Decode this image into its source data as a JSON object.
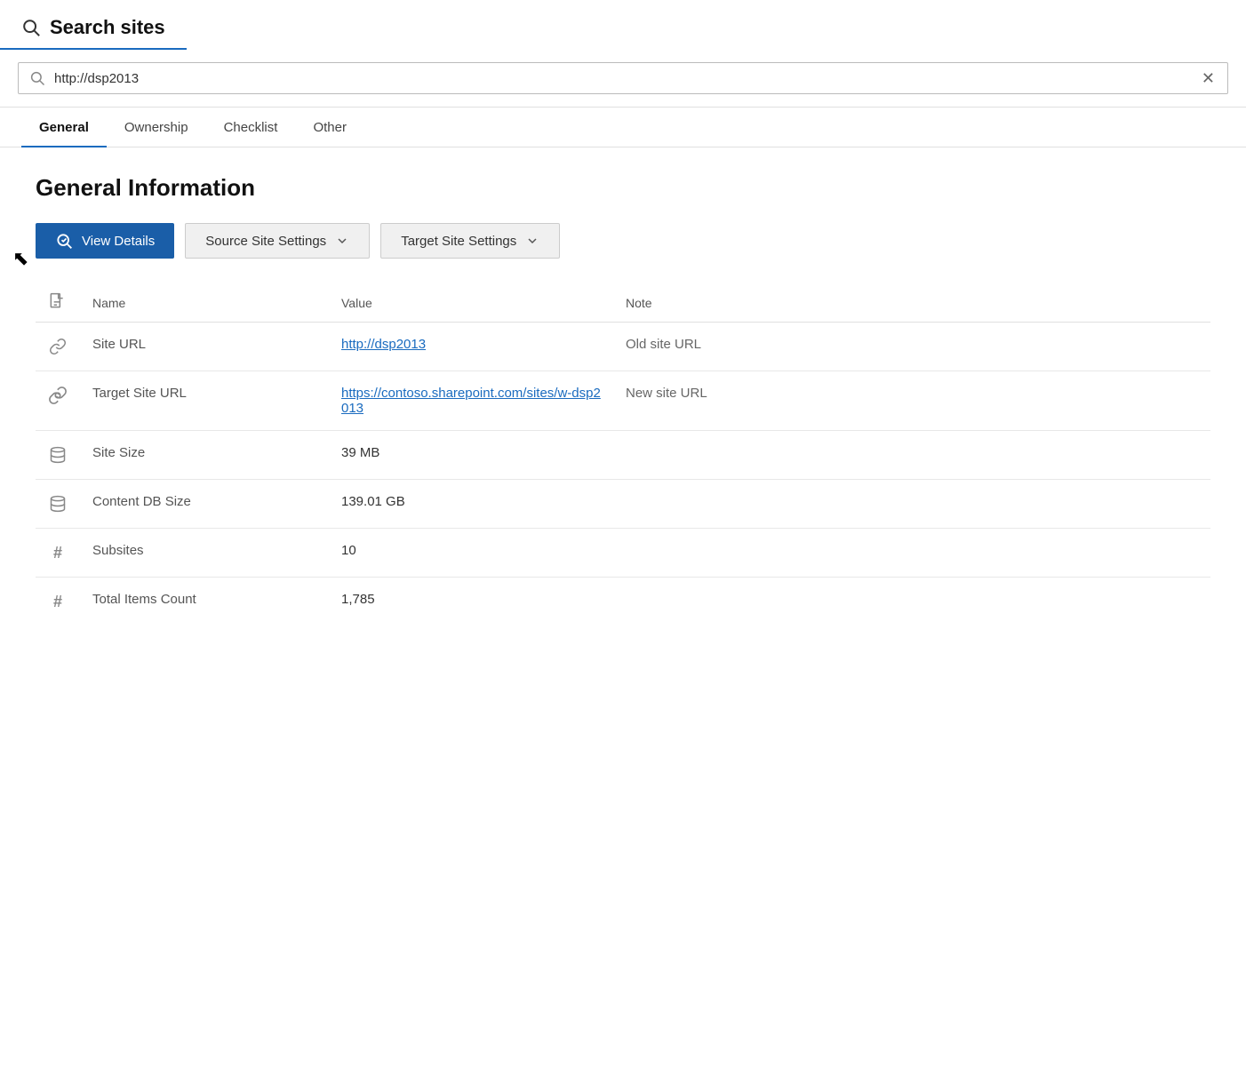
{
  "header": {
    "title": "Search sites",
    "icon": "search-icon"
  },
  "search": {
    "value": "http://dsp2013",
    "placeholder": "Search sites"
  },
  "tabs": [
    {
      "id": "general",
      "label": "General",
      "active": true
    },
    {
      "id": "ownership",
      "label": "Ownership",
      "active": false
    },
    {
      "id": "checklist",
      "label": "Checklist",
      "active": false
    },
    {
      "id": "other",
      "label": "Other",
      "active": false
    }
  ],
  "section": {
    "title": "General Information"
  },
  "buttons": {
    "viewDetails": "View Details",
    "sourceSiteSettings": "Source Site Settings",
    "targetSiteSettings": "Target Site Settings"
  },
  "table": {
    "columns": {
      "name": "Name",
      "value": "Value",
      "note": "Note"
    },
    "rows": [
      {
        "icon": "link",
        "name": "Site URL",
        "value": "http://dsp2013",
        "isLink": true,
        "note": "Old site URL"
      },
      {
        "icon": "target-link",
        "name": "Target Site URL",
        "value": "https://contoso.sharepoint.com/sites/w-dsp2013",
        "isLink": true,
        "note": "New site URL"
      },
      {
        "icon": "database",
        "name": "Site Size",
        "value": "39 MB",
        "isLink": false,
        "note": ""
      },
      {
        "icon": "database",
        "name": "Content DB Size",
        "value": "139.01 GB",
        "isLink": false,
        "note": ""
      },
      {
        "icon": "hash",
        "name": "Subsites",
        "value": "10",
        "isLink": false,
        "note": ""
      },
      {
        "icon": "hash",
        "name": "Total Items Count",
        "value": "1,785",
        "isLink": false,
        "note": ""
      }
    ]
  }
}
